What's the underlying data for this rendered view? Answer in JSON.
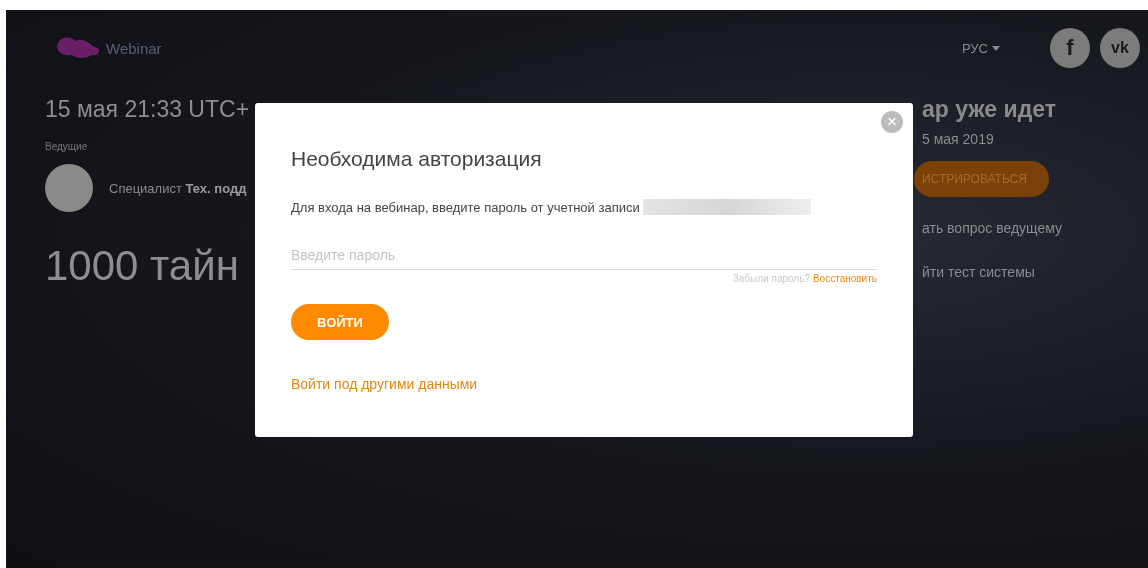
{
  "header": {
    "logo_text": "Webinar",
    "language": "РУС",
    "social": [
      {
        "kind": "facebook",
        "label": "f"
      },
      {
        "kind": "vk",
        "label": "vk"
      }
    ]
  },
  "event": {
    "datetime": "15 мая 21:33 UTC+",
    "hosts_label": "Ведущие",
    "host": "Специалист **Тех. подд**",
    "title": "1000 тайн"
  },
  "side": {
    "status": "ар уже идет",
    "date": "5 мая 2019",
    "register_button": "ИСТРИРОВАТЬСЯ",
    "links": [
      "ать вопрос ведущему",
      "йти тест системы"
    ]
  },
  "modal": {
    "title": "Необходима авторизация",
    "message": "Для входа на вебинар, введите пароль от учетной записи",
    "password": {
      "placeholder": "Введите пароль"
    },
    "forgot_text": "Забыли пароль?",
    "restore_link": "Восстановить",
    "login_button": "ВОЙТИ",
    "other_login_link": "Войти под другими данными",
    "close": "×"
  }
}
